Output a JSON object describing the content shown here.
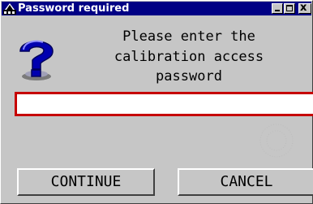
{
  "window": {
    "title": "Password required",
    "controls": {
      "minimize": "_",
      "maximize": "□",
      "close": "x"
    }
  },
  "dialog": {
    "message": "Please enter the\ncalibration access\npassword",
    "icon": "question-mark-icon",
    "password_value": ""
  },
  "buttons": {
    "continue_label": "CONTINUE",
    "cancel_label": "CANCEL"
  },
  "colors": {
    "titlebar": "#000084",
    "face": "#c6c6c6",
    "input_border": "#c60000",
    "icon_blue": "#0000b0"
  }
}
